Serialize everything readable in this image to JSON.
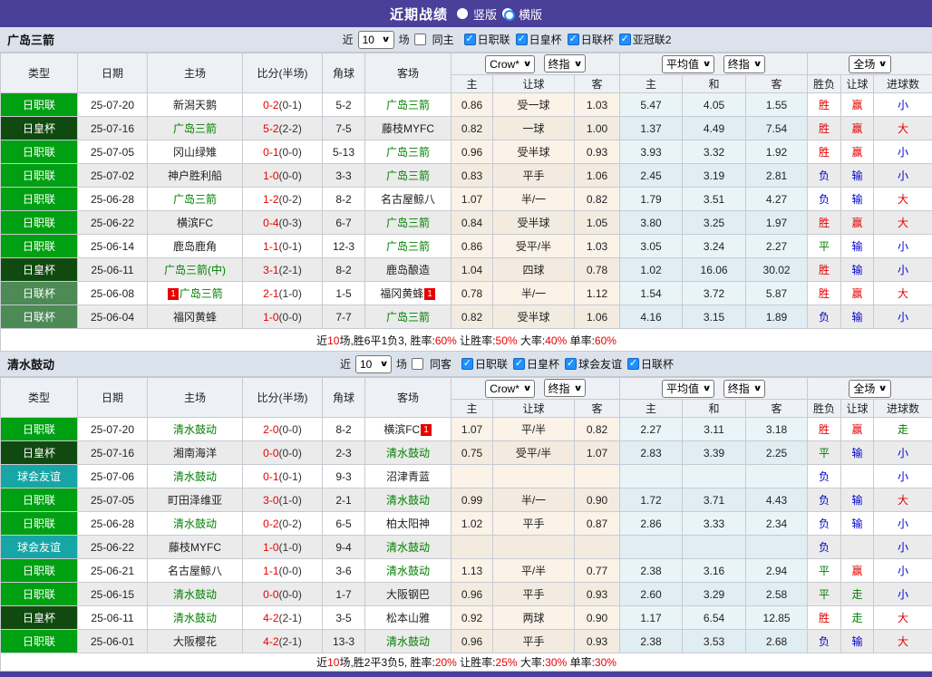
{
  "header": {
    "title": "近期战绩",
    "vertical_label": "竖版",
    "horizontal_label": "横版",
    "layout_selected": "横版"
  },
  "columns": {
    "type": "类型",
    "date": "日期",
    "home": "主场",
    "score": "比分(半场)",
    "corner": "角球",
    "away": "客场",
    "sub": [
      "主",
      "让球",
      "客",
      "主",
      "和",
      "客",
      "胜负",
      "让球",
      "进球数"
    ]
  },
  "dropdowns": {
    "source": "Crow*",
    "source_final": "终指",
    "average": "平均值",
    "average_final": "终指",
    "scope": "全场"
  },
  "colors": {
    "accent_purple": "#4a3f99",
    "league_green": "#00a013",
    "emperor_cup_dark_green": "#114a11",
    "league_cup_green": "#4d8a55",
    "friendly_teal": "#18a5a5",
    "win_red": "#e60000",
    "lose_blue": "#0000cc",
    "draw_green": "#008000",
    "rank_badge_red": "#e60000",
    "checkbox_blue": "#1e90ff"
  },
  "sections": [
    {
      "team": "广岛三箭",
      "filter": {
        "near_label": "近",
        "games_value": "10",
        "games_unit": "场",
        "same_label": "同主",
        "leagues": [
          "日职联",
          "日皇杯",
          "日联杯",
          "亚冠联2"
        ]
      },
      "rows": [
        {
          "type": "日职联",
          "date": "25-07-20",
          "home": "新潟天鹅",
          "home_badge": "",
          "score": "0-2",
          "half": "(0-1)",
          "corner": "5-2",
          "away": "广岛三箭",
          "away_badge": "",
          "h": "0.86",
          "hcp": "受一球",
          "a": "1.03",
          "avg_h": "5.47",
          "avg_d": "4.05",
          "avg_a": "1.55",
          "res": "胜",
          "hcp_res": "赢",
          "goal_res": "小"
        },
        {
          "type": "日皇杯",
          "date": "25-07-16",
          "home": "广岛三箭",
          "home_badge": "",
          "score": "5-2",
          "half": "(2-2)",
          "corner": "7-5",
          "away": "藤枝MYFC",
          "away_badge": "",
          "h": "0.82",
          "hcp": "一球",
          "a": "1.00",
          "avg_h": "1.37",
          "avg_d": "4.49",
          "avg_a": "7.54",
          "res": "胜",
          "hcp_res": "赢",
          "goal_res": "大"
        },
        {
          "type": "日职联",
          "date": "25-07-05",
          "home": "冈山绿雉",
          "home_badge": "",
          "score": "0-1",
          "half": "(0-0)",
          "corner": "5-13",
          "away": "广岛三箭",
          "away_badge": "",
          "h": "0.96",
          "hcp": "受半球",
          "a": "0.93",
          "avg_h": "3.93",
          "avg_d": "3.32",
          "avg_a": "1.92",
          "res": "胜",
          "hcp_res": "赢",
          "goal_res": "小"
        },
        {
          "type": "日职联",
          "date": "25-07-02",
          "home": "神户胜利船",
          "home_badge": "",
          "score": "1-0",
          "half": "(0-0)",
          "corner": "3-3",
          "away": "广岛三箭",
          "away_badge": "",
          "h": "0.83",
          "hcp": "平手",
          "a": "1.06",
          "avg_h": "2.45",
          "avg_d": "3.19",
          "avg_a": "2.81",
          "res": "负",
          "hcp_res": "输",
          "goal_res": "小"
        },
        {
          "type": "日职联",
          "date": "25-06-28",
          "home": "广岛三箭",
          "home_badge": "",
          "score": "1-2",
          "half": "(0-2)",
          "corner": "8-2",
          "away": "名古屋鲸八",
          "away_badge": "",
          "h": "1.07",
          "hcp": "半/一",
          "a": "0.82",
          "avg_h": "1.79",
          "avg_d": "3.51",
          "avg_a": "4.27",
          "res": "负",
          "hcp_res": "输",
          "goal_res": "大"
        },
        {
          "type": "日职联",
          "date": "25-06-22",
          "home": "横滨FC",
          "home_badge": "",
          "score": "0-4",
          "half": "(0-3)",
          "corner": "6-7",
          "away": "广岛三箭",
          "away_badge": "",
          "h": "0.84",
          "hcp": "受半球",
          "a": "1.05",
          "avg_h": "3.80",
          "avg_d": "3.25",
          "avg_a": "1.97",
          "res": "胜",
          "hcp_res": "赢",
          "goal_res": "大"
        },
        {
          "type": "日职联",
          "date": "25-06-14",
          "home": "鹿岛鹿角",
          "home_badge": "",
          "score": "1-1",
          "half": "(0-1)",
          "corner": "12-3",
          "away": "广岛三箭",
          "away_badge": "",
          "h": "0.86",
          "hcp": "受平/半",
          "a": "1.03",
          "avg_h": "3.05",
          "avg_d": "3.24",
          "avg_a": "2.27",
          "res": "平",
          "hcp_res": "输",
          "goal_res": "小"
        },
        {
          "type": "日皇杯",
          "date": "25-06-11",
          "home": "广岛三箭(中)",
          "home_badge": "",
          "score": "3-1",
          "half": "(2-1)",
          "corner": "8-2",
          "away": "鹿岛酿造",
          "away_badge": "",
          "h": "1.04",
          "hcp": "四球",
          "a": "0.78",
          "avg_h": "1.02",
          "avg_d": "16.06",
          "avg_a": "30.02",
          "res": "胜",
          "hcp_res": "输",
          "goal_res": "小"
        },
        {
          "type": "日联杯",
          "date": "25-06-08",
          "home": "广岛三箭",
          "home_badge": "1",
          "score": "2-1",
          "half": "(1-0)",
          "corner": "1-5",
          "away": "福冈黄蜂",
          "away_badge": "1",
          "h": "0.78",
          "hcp": "半/一",
          "a": "1.12",
          "avg_h": "1.54",
          "avg_d": "3.72",
          "avg_a": "5.87",
          "res": "胜",
          "hcp_res": "赢",
          "goal_res": "大"
        },
        {
          "type": "日联杯",
          "date": "25-06-04",
          "home": "福冈黄蜂",
          "home_badge": "",
          "score": "1-0",
          "half": "(0-0)",
          "corner": "7-7",
          "away": "广岛三箭",
          "away_badge": "",
          "h": "0.82",
          "hcp": "受半球",
          "a": "1.06",
          "avg_h": "4.16",
          "avg_d": "3.15",
          "avg_a": "1.89",
          "res": "负",
          "hcp_res": "输",
          "goal_res": "小"
        }
      ],
      "summary": [
        {
          "t": "近"
        },
        {
          "t": "10",
          "r": 1
        },
        {
          "t": "场,胜6平1负3, 胜率:"
        },
        {
          "t": "60%",
          "r": 1
        },
        {
          "t": " 让胜率:"
        },
        {
          "t": "50%",
          "r": 1
        },
        {
          "t": " 大率:"
        },
        {
          "t": "40%",
          "r": 1
        },
        {
          "t": " 单率:"
        },
        {
          "t": "60%",
          "r": 1
        }
      ]
    },
    {
      "team": "清水鼓动",
      "filter": {
        "near_label": "近",
        "games_value": "10",
        "games_unit": "场",
        "same_label": "同客",
        "leagues": [
          "日职联",
          "日皇杯",
          "球会友谊",
          "日联杯"
        ]
      },
      "rows": [
        {
          "type": "日职联",
          "date": "25-07-20",
          "home": "清水鼓动",
          "home_badge": "",
          "score": "2-0",
          "half": "(0-0)",
          "corner": "8-2",
          "away": "横滨FC",
          "away_badge": "1",
          "h": "1.07",
          "hcp": "平/半",
          "a": "0.82",
          "avg_h": "2.27",
          "avg_d": "3.11",
          "avg_a": "3.18",
          "res": "胜",
          "hcp_res": "赢",
          "goal_res": "走"
        },
        {
          "type": "日皇杯",
          "date": "25-07-16",
          "home": "湘南海洋",
          "home_badge": "",
          "score": "0-0",
          "half": "(0-0)",
          "corner": "2-3",
          "away": "清水鼓动",
          "away_badge": "",
          "h": "0.75",
          "hcp": "受平/半",
          "a": "1.07",
          "avg_h": "2.83",
          "avg_d": "3.39",
          "avg_a": "2.25",
          "res": "平",
          "hcp_res": "输",
          "goal_res": "小"
        },
        {
          "type": "球会友谊",
          "date": "25-07-06",
          "home": "清水鼓动",
          "home_badge": "",
          "score": "0-1",
          "half": "(0-1)",
          "corner": "9-3",
          "away": "沼津青蓝",
          "away_badge": "",
          "h": "",
          "hcp": "",
          "a": "",
          "avg_h": "",
          "avg_d": "",
          "avg_a": "",
          "res": "负",
          "hcp_res": "",
          "goal_res": "小"
        },
        {
          "type": "日职联",
          "date": "25-07-05",
          "home": "町田泽维亚",
          "home_badge": "",
          "score": "3-0",
          "half": "(1-0)",
          "corner": "2-1",
          "away": "清水鼓动",
          "away_badge": "",
          "h": "0.99",
          "hcp": "半/一",
          "a": "0.90",
          "avg_h": "1.72",
          "avg_d": "3.71",
          "avg_a": "4.43",
          "res": "负",
          "hcp_res": "输",
          "goal_res": "大"
        },
        {
          "type": "日职联",
          "date": "25-06-28",
          "home": "清水鼓动",
          "home_badge": "",
          "score": "0-2",
          "half": "(0-2)",
          "corner": "6-5",
          "away": "柏太阳神",
          "away_badge": "",
          "h": "1.02",
          "hcp": "平手",
          "a": "0.87",
          "avg_h": "2.86",
          "avg_d": "3.33",
          "avg_a": "2.34",
          "res": "负",
          "hcp_res": "输",
          "goal_res": "小"
        },
        {
          "type": "球会友谊",
          "date": "25-06-22",
          "home": "藤枝MYFC",
          "home_badge": "",
          "score": "1-0",
          "half": "(1-0)",
          "corner": "9-4",
          "away": "清水鼓动",
          "away_badge": "",
          "h": "",
          "hcp": "",
          "a": "",
          "avg_h": "",
          "avg_d": "",
          "avg_a": "",
          "res": "负",
          "hcp_res": "",
          "goal_res": "小"
        },
        {
          "type": "日职联",
          "date": "25-06-21",
          "home": "名古屋鲸八",
          "home_badge": "",
          "score": "1-1",
          "half": "(0-0)",
          "corner": "3-6",
          "away": "清水鼓动",
          "away_badge": "",
          "h": "1.13",
          "hcp": "平/半",
          "a": "0.77",
          "avg_h": "2.38",
          "avg_d": "3.16",
          "avg_a": "2.94",
          "res": "平",
          "hcp_res": "赢",
          "goal_res": "小"
        },
        {
          "type": "日职联",
          "date": "25-06-15",
          "home": "清水鼓动",
          "home_badge": "",
          "score": "0-0",
          "half": "(0-0)",
          "corner": "1-7",
          "away": "大阪钢巴",
          "away_badge": "",
          "h": "0.96",
          "hcp": "平手",
          "a": "0.93",
          "avg_h": "2.60",
          "avg_d": "3.29",
          "avg_a": "2.58",
          "res": "平",
          "hcp_res": "走",
          "goal_res": "小"
        },
        {
          "type": "日皇杯",
          "date": "25-06-11",
          "home": "清水鼓动",
          "home_badge": "",
          "score": "4-2",
          "half": "(2-1)",
          "corner": "3-5",
          "away": "松本山雅",
          "away_badge": "",
          "h": "0.92",
          "hcp": "两球",
          "a": "0.90",
          "avg_h": "1.17",
          "avg_d": "6.54",
          "avg_a": "12.85",
          "res": "胜",
          "hcp_res": "走",
          "goal_res": "大"
        },
        {
          "type": "日职联",
          "date": "25-06-01",
          "home": "大阪樱花",
          "home_badge": "",
          "score": "4-2",
          "half": "(2-1)",
          "corner": "13-3",
          "away": "清水鼓动",
          "away_badge": "",
          "h": "0.96",
          "hcp": "平手",
          "a": "0.93",
          "avg_h": "2.38",
          "avg_d": "3.53",
          "avg_a": "2.68",
          "res": "负",
          "hcp_res": "输",
          "goal_res": "大"
        }
      ],
      "summary": [
        {
          "t": "近"
        },
        {
          "t": "10",
          "r": 1
        },
        {
          "t": "场,胜2平3负5, 胜率:"
        },
        {
          "t": "20%",
          "r": 1
        },
        {
          "t": " 让胜率:"
        },
        {
          "t": "25%",
          "r": 1
        },
        {
          "t": " 大率:"
        },
        {
          "t": "30%",
          "r": 1
        },
        {
          "t": " 单率:"
        },
        {
          "t": "30%",
          "r": 1
        }
      ]
    }
  ]
}
